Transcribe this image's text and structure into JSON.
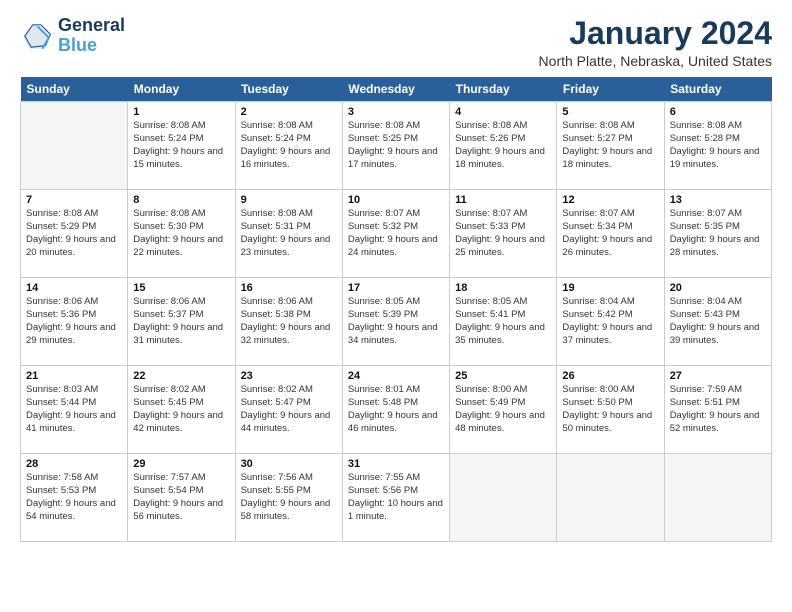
{
  "logo": {
    "line1": "General",
    "line2": "Blue"
  },
  "title": "January 2024",
  "subtitle": "North Platte, Nebraska, United States",
  "weekdays": [
    "Sunday",
    "Monday",
    "Tuesday",
    "Wednesday",
    "Thursday",
    "Friday",
    "Saturday"
  ],
  "weeks": [
    [
      {
        "day": "",
        "sunrise": "",
        "sunset": "",
        "daylight": ""
      },
      {
        "day": "1",
        "sunrise": "Sunrise: 8:08 AM",
        "sunset": "Sunset: 5:24 PM",
        "daylight": "Daylight: 9 hours and 15 minutes."
      },
      {
        "day": "2",
        "sunrise": "Sunrise: 8:08 AM",
        "sunset": "Sunset: 5:24 PM",
        "daylight": "Daylight: 9 hours and 16 minutes."
      },
      {
        "day": "3",
        "sunrise": "Sunrise: 8:08 AM",
        "sunset": "Sunset: 5:25 PM",
        "daylight": "Daylight: 9 hours and 17 minutes."
      },
      {
        "day": "4",
        "sunrise": "Sunrise: 8:08 AM",
        "sunset": "Sunset: 5:26 PM",
        "daylight": "Daylight: 9 hours and 18 minutes."
      },
      {
        "day": "5",
        "sunrise": "Sunrise: 8:08 AM",
        "sunset": "Sunset: 5:27 PM",
        "daylight": "Daylight: 9 hours and 18 minutes."
      },
      {
        "day": "6",
        "sunrise": "Sunrise: 8:08 AM",
        "sunset": "Sunset: 5:28 PM",
        "daylight": "Daylight: 9 hours and 19 minutes."
      }
    ],
    [
      {
        "day": "7",
        "sunrise": "Sunrise: 8:08 AM",
        "sunset": "Sunset: 5:29 PM",
        "daylight": "Daylight: 9 hours and 20 minutes."
      },
      {
        "day": "8",
        "sunrise": "Sunrise: 8:08 AM",
        "sunset": "Sunset: 5:30 PM",
        "daylight": "Daylight: 9 hours and 22 minutes."
      },
      {
        "day": "9",
        "sunrise": "Sunrise: 8:08 AM",
        "sunset": "Sunset: 5:31 PM",
        "daylight": "Daylight: 9 hours and 23 minutes."
      },
      {
        "day": "10",
        "sunrise": "Sunrise: 8:07 AM",
        "sunset": "Sunset: 5:32 PM",
        "daylight": "Daylight: 9 hours and 24 minutes."
      },
      {
        "day": "11",
        "sunrise": "Sunrise: 8:07 AM",
        "sunset": "Sunset: 5:33 PM",
        "daylight": "Daylight: 9 hours and 25 minutes."
      },
      {
        "day": "12",
        "sunrise": "Sunrise: 8:07 AM",
        "sunset": "Sunset: 5:34 PM",
        "daylight": "Daylight: 9 hours and 26 minutes."
      },
      {
        "day": "13",
        "sunrise": "Sunrise: 8:07 AM",
        "sunset": "Sunset: 5:35 PM",
        "daylight": "Daylight: 9 hours and 28 minutes."
      }
    ],
    [
      {
        "day": "14",
        "sunrise": "Sunrise: 8:06 AM",
        "sunset": "Sunset: 5:36 PM",
        "daylight": "Daylight: 9 hours and 29 minutes."
      },
      {
        "day": "15",
        "sunrise": "Sunrise: 8:06 AM",
        "sunset": "Sunset: 5:37 PM",
        "daylight": "Daylight: 9 hours and 31 minutes."
      },
      {
        "day": "16",
        "sunrise": "Sunrise: 8:06 AM",
        "sunset": "Sunset: 5:38 PM",
        "daylight": "Daylight: 9 hours and 32 minutes."
      },
      {
        "day": "17",
        "sunrise": "Sunrise: 8:05 AM",
        "sunset": "Sunset: 5:39 PM",
        "daylight": "Daylight: 9 hours and 34 minutes."
      },
      {
        "day": "18",
        "sunrise": "Sunrise: 8:05 AM",
        "sunset": "Sunset: 5:41 PM",
        "daylight": "Daylight: 9 hours and 35 minutes."
      },
      {
        "day": "19",
        "sunrise": "Sunrise: 8:04 AM",
        "sunset": "Sunset: 5:42 PM",
        "daylight": "Daylight: 9 hours and 37 minutes."
      },
      {
        "day": "20",
        "sunrise": "Sunrise: 8:04 AM",
        "sunset": "Sunset: 5:43 PM",
        "daylight": "Daylight: 9 hours and 39 minutes."
      }
    ],
    [
      {
        "day": "21",
        "sunrise": "Sunrise: 8:03 AM",
        "sunset": "Sunset: 5:44 PM",
        "daylight": "Daylight: 9 hours and 41 minutes."
      },
      {
        "day": "22",
        "sunrise": "Sunrise: 8:02 AM",
        "sunset": "Sunset: 5:45 PM",
        "daylight": "Daylight: 9 hours and 42 minutes."
      },
      {
        "day": "23",
        "sunrise": "Sunrise: 8:02 AM",
        "sunset": "Sunset: 5:47 PM",
        "daylight": "Daylight: 9 hours and 44 minutes."
      },
      {
        "day": "24",
        "sunrise": "Sunrise: 8:01 AM",
        "sunset": "Sunset: 5:48 PM",
        "daylight": "Daylight: 9 hours and 46 minutes."
      },
      {
        "day": "25",
        "sunrise": "Sunrise: 8:00 AM",
        "sunset": "Sunset: 5:49 PM",
        "daylight": "Daylight: 9 hours and 48 minutes."
      },
      {
        "day": "26",
        "sunrise": "Sunrise: 8:00 AM",
        "sunset": "Sunset: 5:50 PM",
        "daylight": "Daylight: 9 hours and 50 minutes."
      },
      {
        "day": "27",
        "sunrise": "Sunrise: 7:59 AM",
        "sunset": "Sunset: 5:51 PM",
        "daylight": "Daylight: 9 hours and 52 minutes."
      }
    ],
    [
      {
        "day": "28",
        "sunrise": "Sunrise: 7:58 AM",
        "sunset": "Sunset: 5:53 PM",
        "daylight": "Daylight: 9 hours and 54 minutes."
      },
      {
        "day": "29",
        "sunrise": "Sunrise: 7:57 AM",
        "sunset": "Sunset: 5:54 PM",
        "daylight": "Daylight: 9 hours and 56 minutes."
      },
      {
        "day": "30",
        "sunrise": "Sunrise: 7:56 AM",
        "sunset": "Sunset: 5:55 PM",
        "daylight": "Daylight: 9 hours and 58 minutes."
      },
      {
        "day": "31",
        "sunrise": "Sunrise: 7:55 AM",
        "sunset": "Sunset: 5:56 PM",
        "daylight": "Daylight: 10 hours and 1 minute."
      },
      {
        "day": "",
        "sunrise": "",
        "sunset": "",
        "daylight": ""
      },
      {
        "day": "",
        "sunrise": "",
        "sunset": "",
        "daylight": ""
      },
      {
        "day": "",
        "sunrise": "",
        "sunset": "",
        "daylight": ""
      }
    ]
  ]
}
